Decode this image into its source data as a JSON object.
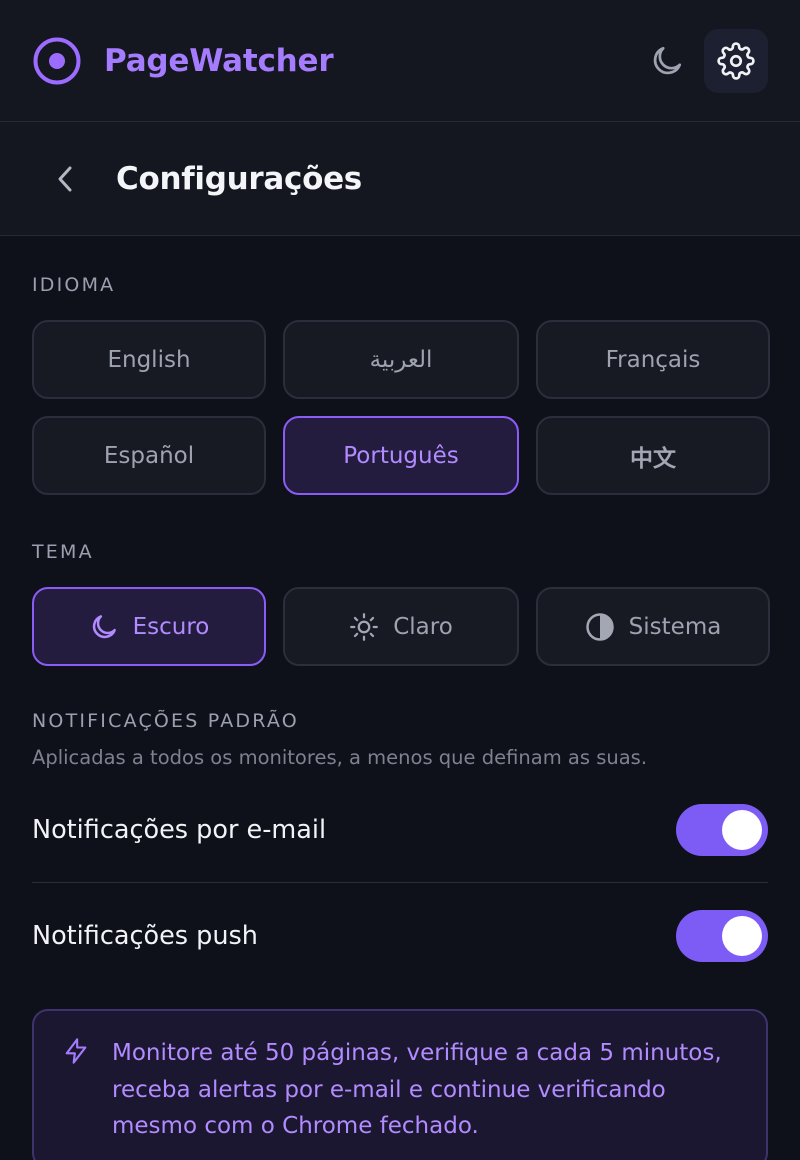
{
  "app": {
    "title": "PageWatcher"
  },
  "header": {
    "theme_icon": "moon-icon",
    "settings_icon": "gear-icon",
    "accent": "#a67cff"
  },
  "subheader": {
    "back_icon": "chevron-left-icon",
    "title": "Configurações"
  },
  "language": {
    "label": "IDIOMA",
    "options": [
      "English",
      "العربية",
      "Français",
      "Español",
      "Português",
      "中文"
    ],
    "selected": "Português"
  },
  "theme": {
    "label": "TEMA",
    "options": [
      {
        "label": "Escuro",
        "icon": "moon-icon"
      },
      {
        "label": "Claro",
        "icon": "sun-icon"
      },
      {
        "label": "Sistema",
        "icon": "half-circle-icon"
      }
    ],
    "selected": "Escuro"
  },
  "notifications": {
    "label": "NOTIFICAÇÕES PADRÃO",
    "description": "Aplicadas a todos os monitores, a menos que definam as suas.",
    "email": {
      "label": "Notificações por e-mail",
      "enabled": true
    },
    "push": {
      "label": "Notificações push",
      "enabled": true
    },
    "toggle_color": "#7c5cf5"
  },
  "promo": {
    "icon": "lightning-icon",
    "text": "Monitore até 50 páginas, verifique a cada 5 minutos, receba alertas por e-mail e continue verificando mesmo com o Chrome fechado."
  }
}
